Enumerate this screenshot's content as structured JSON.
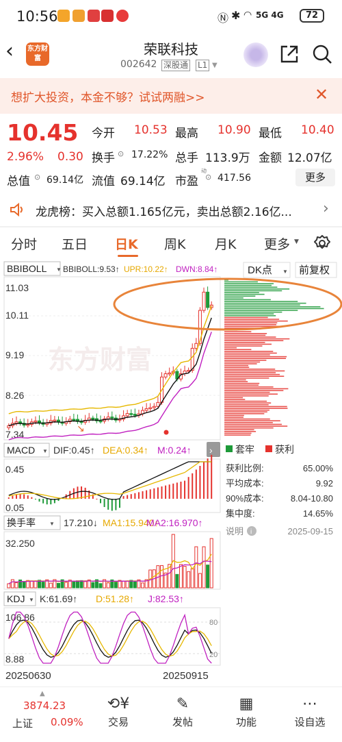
{
  "status_bar": {
    "time": "10:56",
    "network": "5G  4G",
    "battery": "72"
  },
  "header": {
    "app_logo": "东方财富",
    "title": "荣联科技",
    "code": "002642",
    "exchange_tag": "深股通",
    "level": "L1"
  },
  "banner": {
    "text": "想扩大投资，本金不够？试试两融>>"
  },
  "quote": {
    "price": "10.45",
    "change_pct": "2.96%",
    "change": "0.30",
    "open_label": "今开",
    "open": "10.53",
    "high_label": "最高",
    "high": "10.90",
    "low_label": "最低",
    "low": "10.40",
    "turnover_label": "换手",
    "turnover": "17.22%",
    "volume_label": "总手",
    "volume": "113.9万",
    "amount_label": "金额",
    "amount": "12.07亿",
    "mktcap_label": "总值",
    "mktcap": "69.14亿",
    "float_label": "流值",
    "float": "69.14亿",
    "pe_label": "市盈",
    "pe_sup": "动",
    "pe": "417.56",
    "more": "更多"
  },
  "dragon_tiger": {
    "text": "龙虎榜：买入总额1.165亿元，卖出总额2.16亿..."
  },
  "tabs": {
    "t1": "分时",
    "t2": "五日",
    "t3": "日K",
    "t4": "周K",
    "t5": "月K",
    "t6": "更多"
  },
  "chart_labels": {
    "boll_name": "BBIBOLL",
    "boll_val": "BBIBOLL:9.53↑",
    "boll_upr": "UPR:10.22↑",
    "boll_dwn": "DWN:8.84↑",
    "dk": "DK点",
    "adjust": "前复权",
    "y1": "11.03",
    "y2": "10.11",
    "y3": "9.19",
    "y4": "8.26",
    "y5": "7.34",
    "watermark": "东方财富",
    "macd_name": "MACD",
    "macd_dif": "DIF:0.45↑",
    "macd_dea": "DEA:0.34↑",
    "macd_m": "M:0.24↑",
    "macd_top": "0.45",
    "macd_bot": "0.05",
    "hs_name": "换手率",
    "hs_val": "17.210↓",
    "hs_ma1": "MA1:15.940↑",
    "hs_ma2": "MA2:16.970↑",
    "hs_top": "32.250",
    "kdj_name": "KDJ",
    "kdj_k": "K:61.69↑",
    "kdj_d": "D:51.28↑",
    "kdj_j": "J:82.53↑",
    "kdj_top": "106.86",
    "kdj_bot": "8.88",
    "kdj_r80": "80",
    "kdj_r20": "20",
    "date_start": "20250630",
    "date_end": "20250915"
  },
  "cost_panel": {
    "legend_trap": "套牢",
    "legend_profit": "获利",
    "profit_ratio_label": "获利比例:",
    "profit_ratio": "65.00%",
    "avg_cost_label": "平均成本:",
    "avg_cost": "9.92",
    "cost90_label": "90%成本:",
    "cost90": "8.04-10.80",
    "concentration_label": "集中度:",
    "concentration": "14.65%",
    "note_label": "说明",
    "date": "2025-09-15"
  },
  "bottom_nav": {
    "index_value": "3874.23",
    "index_name": "上证",
    "index_pct": "0.09%",
    "trade": "交易",
    "post": "发帖",
    "func": "功能",
    "watchlist": "设自选"
  },
  "colors": {
    "up": "#e5322d",
    "down": "#1e9a39",
    "accent": "#e8692a",
    "banner_bg": "#fdeee9"
  },
  "chart_data": {
    "type": "candlestick",
    "x_range": [
      "20250630",
      "20250915"
    ],
    "ylim": [
      7.34,
      11.03
    ],
    "indicators": [
      "BBIBOLL",
      "MACD",
      "换手率",
      "KDJ"
    ]
  }
}
